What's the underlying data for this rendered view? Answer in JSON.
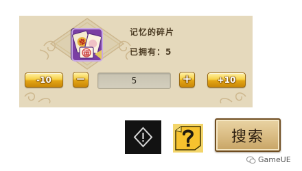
{
  "item": {
    "name": "记忆的碎片",
    "icon": "memory-fragment-card-icon",
    "owned_label": "已拥有：",
    "owned_count": "5"
  },
  "quantity": {
    "value": "5",
    "minus10_label": "-10",
    "minus1_label": "−",
    "plus1_label": "+",
    "plus10_label": "+10"
  },
  "actions": {
    "alert_icon": "alert-diamond-icon",
    "help_icon": "question-mark-icon",
    "search_label": "搜索"
  },
  "watermark": {
    "text": "GameUE"
  },
  "colors": {
    "panel_bg": "#e5d9bc",
    "gold_button": "#f7d045",
    "search_button": "#d9bb82",
    "item_purple": "#7a3fa3"
  }
}
